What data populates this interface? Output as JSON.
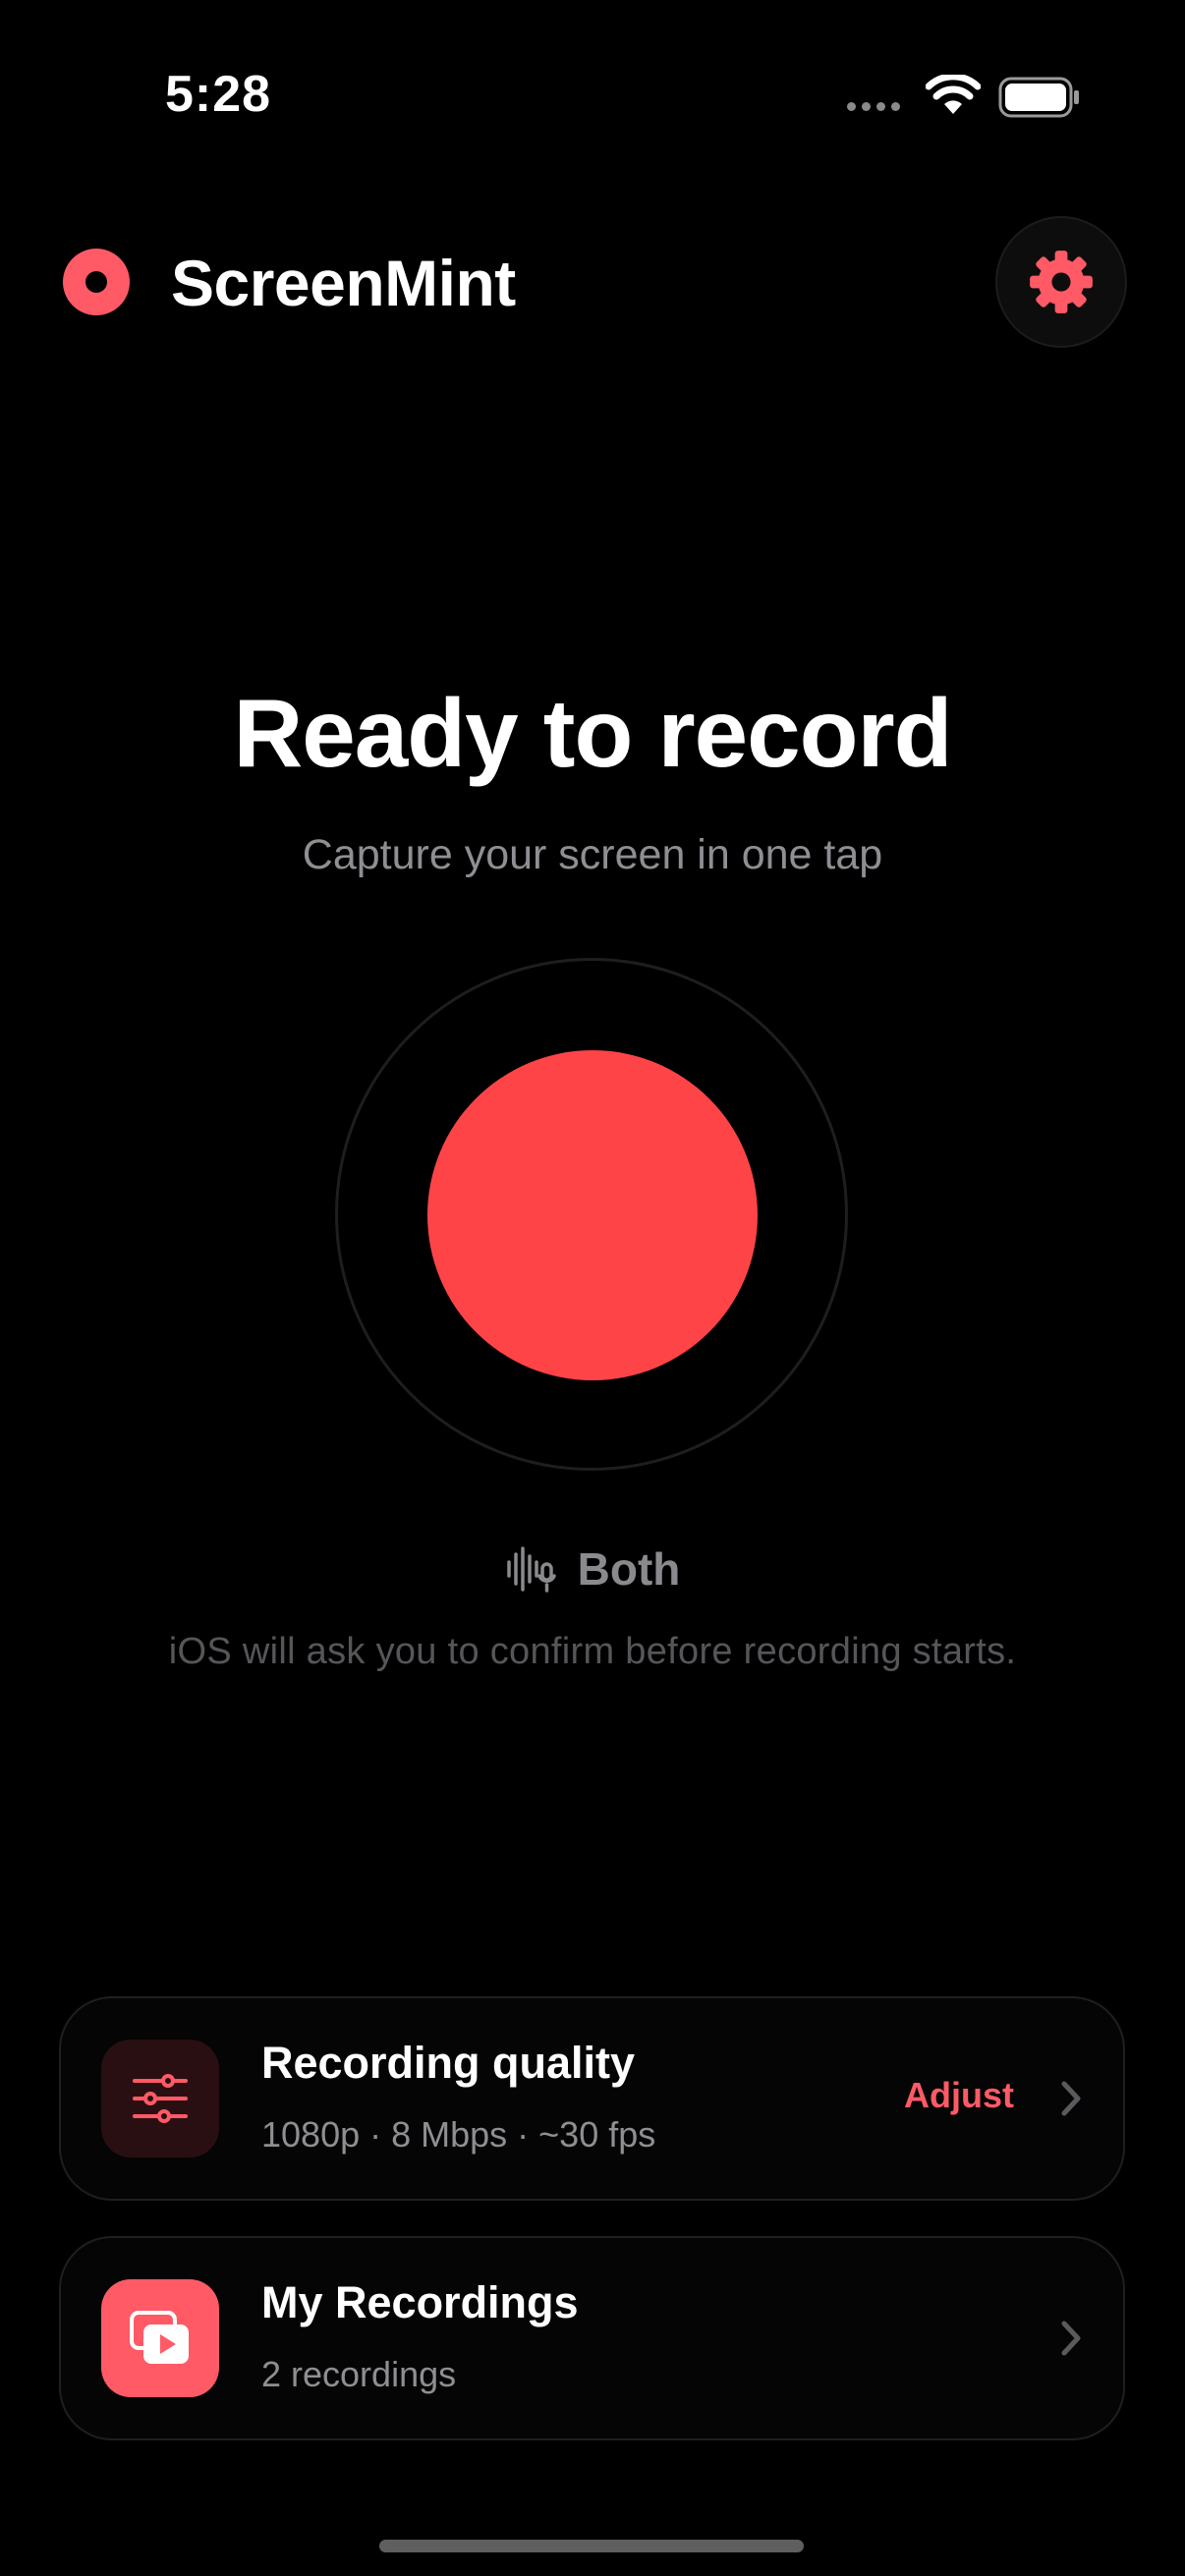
{
  "status_bar": {
    "time": "5:28"
  },
  "header": {
    "title": "ScreenMint"
  },
  "hero": {
    "title": "Ready to record",
    "subtitle": "Capture your screen in one tap"
  },
  "audio": {
    "mode_label": "Both",
    "confirm_note": "iOS will ask you to confirm before recording starts."
  },
  "cards": {
    "quality": {
      "title": "Recording quality",
      "subtitle": "1080p · 8 Mbps · ~30 fps",
      "action": "Adjust"
    },
    "recordings": {
      "title": "My Recordings",
      "subtitle": "2 recordings"
    }
  },
  "colors": {
    "accent": "#ff5a66",
    "record": "#ff4448",
    "background": "#000000"
  }
}
